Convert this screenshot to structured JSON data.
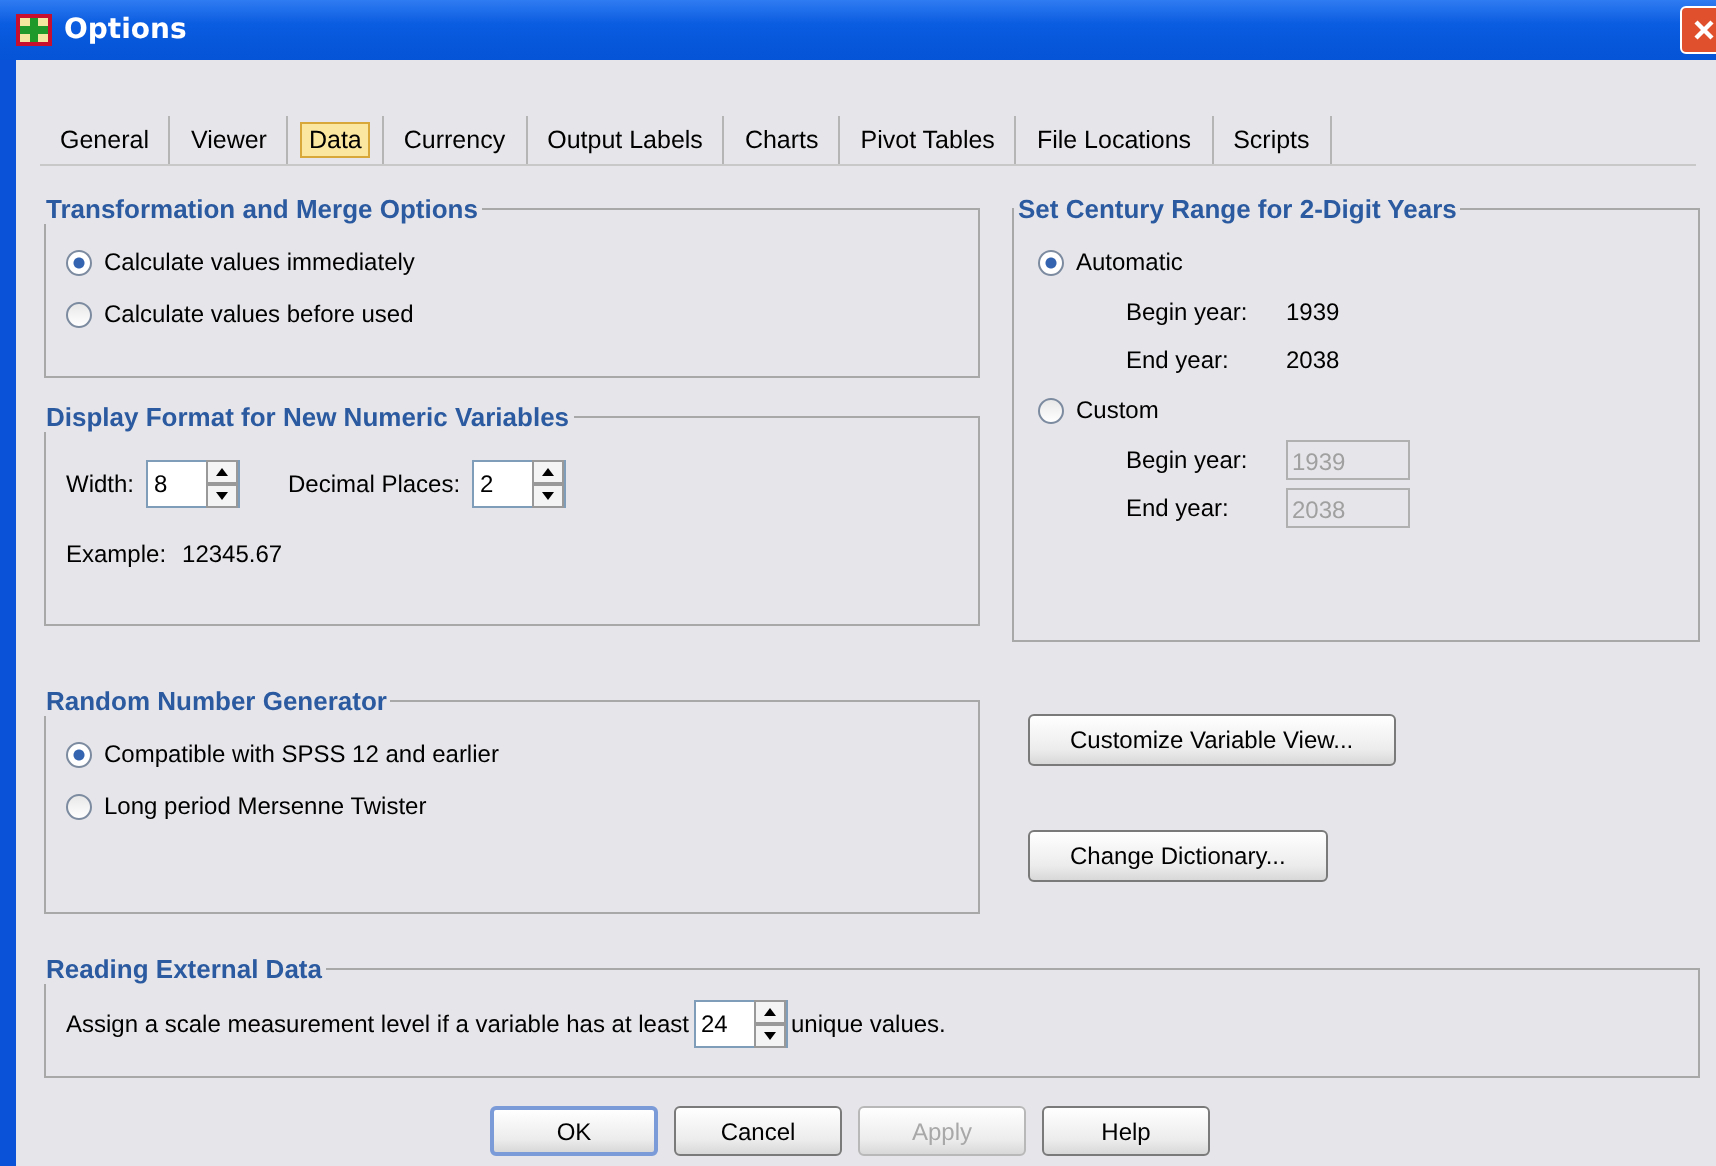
{
  "window": {
    "title": "Options"
  },
  "tabs": [
    {
      "label": "General",
      "selected": false
    },
    {
      "label": "Viewer",
      "selected": false
    },
    {
      "label": "Data",
      "selected": true
    },
    {
      "label": "Currency",
      "selected": false
    },
    {
      "label": "Output Labels",
      "selected": false
    },
    {
      "label": "Charts",
      "selected": false
    },
    {
      "label": "Pivot Tables",
      "selected": false
    },
    {
      "label": "File Locations",
      "selected": false
    },
    {
      "label": "Scripts",
      "selected": false
    }
  ],
  "transformation": {
    "title": "Transformation and Merge Options",
    "options": [
      {
        "label": "Calculate values immediately",
        "selected": true
      },
      {
        "label": "Calculate values before used",
        "selected": false
      }
    ]
  },
  "display_format": {
    "title": "Display Format for New Numeric Variables",
    "spinners": [
      {
        "label": "Width:",
        "value": "8"
      },
      {
        "label": "Decimal Places:",
        "value": "2"
      }
    ],
    "example_label": "Example:",
    "example_value": "12345.67"
  },
  "century": {
    "title": "Set Century Range for 2-Digit Years",
    "options": [
      {
        "label": "Automatic",
        "selected": true,
        "fields": [
          {
            "kind": "readout",
            "label": "Begin year:",
            "value": "1939"
          },
          {
            "kind": "readout",
            "label": "End year:",
            "value": "2038"
          }
        ]
      },
      {
        "label": "Custom",
        "selected": false,
        "fields": [
          {
            "kind": "entry",
            "label": "Begin year:",
            "value": "1939",
            "disabled": true
          },
          {
            "kind": "entry",
            "label": "End year:",
            "value": "2038",
            "disabled": true
          }
        ]
      }
    ]
  },
  "random": {
    "title": "Random Number Generator",
    "options": [
      {
        "label": "Compatible with SPSS 12 and earlier",
        "selected": true
      },
      {
        "label": "Long period Mersenne Twister",
        "selected": false
      }
    ]
  },
  "side_buttons": [
    "Customize Variable View...",
    "Change Dictionary..."
  ],
  "external": {
    "title": "Reading External Data",
    "text_before": "Assign a scale measurement level if a variable has at least",
    "value": "24",
    "text_after": "unique values."
  },
  "buttons": [
    {
      "label": "OK",
      "default": true,
      "disabled": false
    },
    {
      "label": "Cancel",
      "default": false,
      "disabled": false
    },
    {
      "label": "Apply",
      "default": false,
      "disabled": true
    },
    {
      "label": "Help",
      "default": false,
      "disabled": false
    }
  ]
}
